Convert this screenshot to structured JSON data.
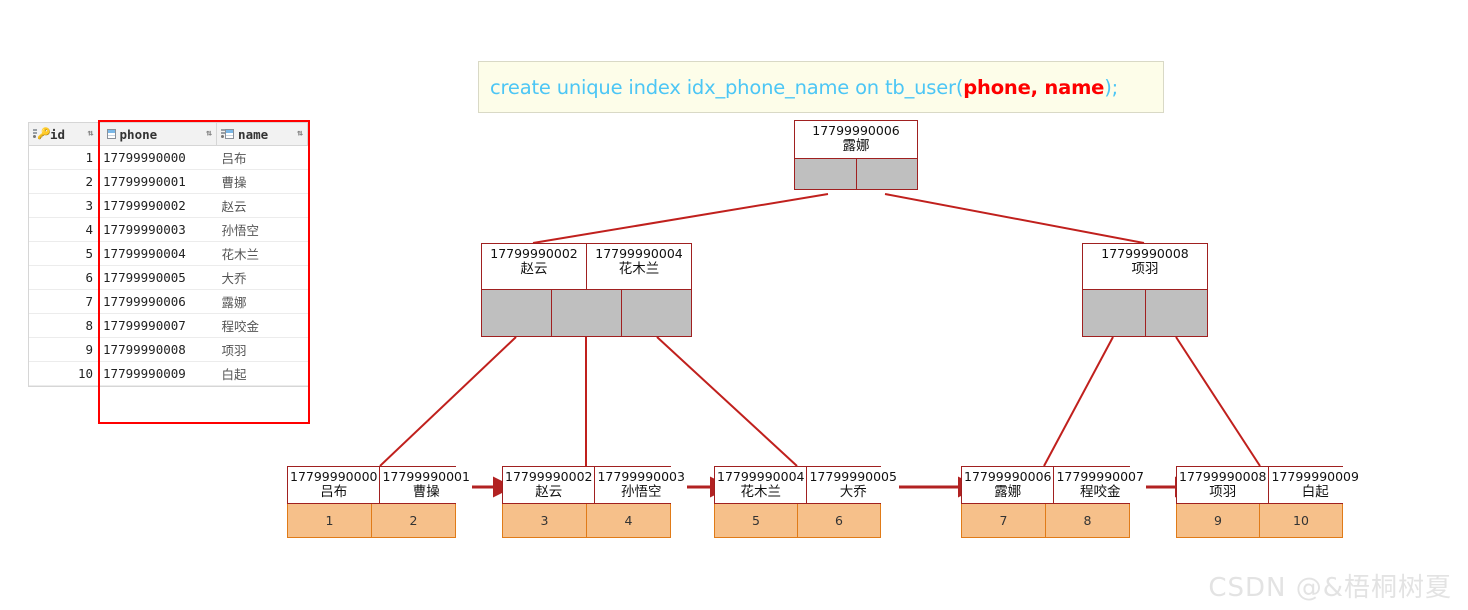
{
  "sql": {
    "prefix": "create unique index idx_phone_name on tb_user(",
    "highlight": "phone, name",
    "suffix": ");"
  },
  "grid": {
    "columns": [
      {
        "key": "id",
        "label": "id",
        "icon": "primary-key-icon"
      },
      {
        "key": "phone",
        "label": "phone",
        "icon": "column-table-icon"
      },
      {
        "key": "name",
        "label": "name",
        "icon": "column-table-icon"
      }
    ],
    "sort_indicator": "⇅",
    "rows": [
      {
        "id": "1",
        "phone": "17799990000",
        "name": "吕布"
      },
      {
        "id": "2",
        "phone": "17799990001",
        "name": "曹操"
      },
      {
        "id": "3",
        "phone": "17799990002",
        "name": "赵云"
      },
      {
        "id": "4",
        "phone": "17799990003",
        "name": "孙悟空"
      },
      {
        "id": "5",
        "phone": "17799990004",
        "name": "花木兰"
      },
      {
        "id": "6",
        "phone": "17799990005",
        "name": "大乔"
      },
      {
        "id": "7",
        "phone": "17799990006",
        "name": "露娜"
      },
      {
        "id": "8",
        "phone": "17799990007",
        "name": "程咬金"
      },
      {
        "id": "9",
        "phone": "17799990008",
        "name": "项羽"
      },
      {
        "id": "10",
        "phone": "17799990009",
        "name": "白起"
      }
    ]
  },
  "tree": {
    "root": {
      "keys": [
        {
          "phone": "17799990006",
          "name": "露娜"
        }
      ],
      "pointers": 2
    },
    "internal": [
      {
        "keys": [
          {
            "phone": "17799990002",
            "name": "赵云"
          },
          {
            "phone": "17799990004",
            "name": "花木兰"
          }
        ],
        "pointers": 3
      },
      {
        "keys": [
          {
            "phone": "17799990008",
            "name": "项羽"
          }
        ],
        "pointers": 2
      }
    ],
    "leaves": [
      {
        "entries": [
          {
            "phone": "17799990000",
            "name": "吕布",
            "id": "1"
          },
          {
            "phone": "17799990001",
            "name": "曹操",
            "id": "2"
          }
        ]
      },
      {
        "entries": [
          {
            "phone": "17799990002",
            "name": "赵云",
            "id": "3"
          },
          {
            "phone": "17799990003",
            "name": "孙悟空",
            "id": "4"
          }
        ]
      },
      {
        "entries": [
          {
            "phone": "17799990004",
            "name": "花木兰",
            "id": "5"
          },
          {
            "phone": "17799990005",
            "name": "大乔",
            "id": "6"
          }
        ]
      },
      {
        "entries": [
          {
            "phone": "17799990006",
            "name": "露娜",
            "id": "7"
          },
          {
            "phone": "17799990007",
            "name": "程咬金",
            "id": "8"
          }
        ]
      },
      {
        "entries": [
          {
            "phone": "17799990008",
            "name": "项羽",
            "id": "9"
          },
          {
            "phone": "17799990009",
            "name": "白起",
            "id": "10"
          }
        ]
      }
    ]
  },
  "colors": {
    "node_border": "#a02020",
    "pointer_fill": "#bfbfbf",
    "leaf_id_fill": "#f6c08a",
    "leaf_id_border": "#e07b18",
    "sql_keyword": "#4cc6f5",
    "sql_highlight": "#fd0000",
    "highlight_rect": "#ff0000"
  },
  "watermark": "CSDN @&梧桐树夏"
}
